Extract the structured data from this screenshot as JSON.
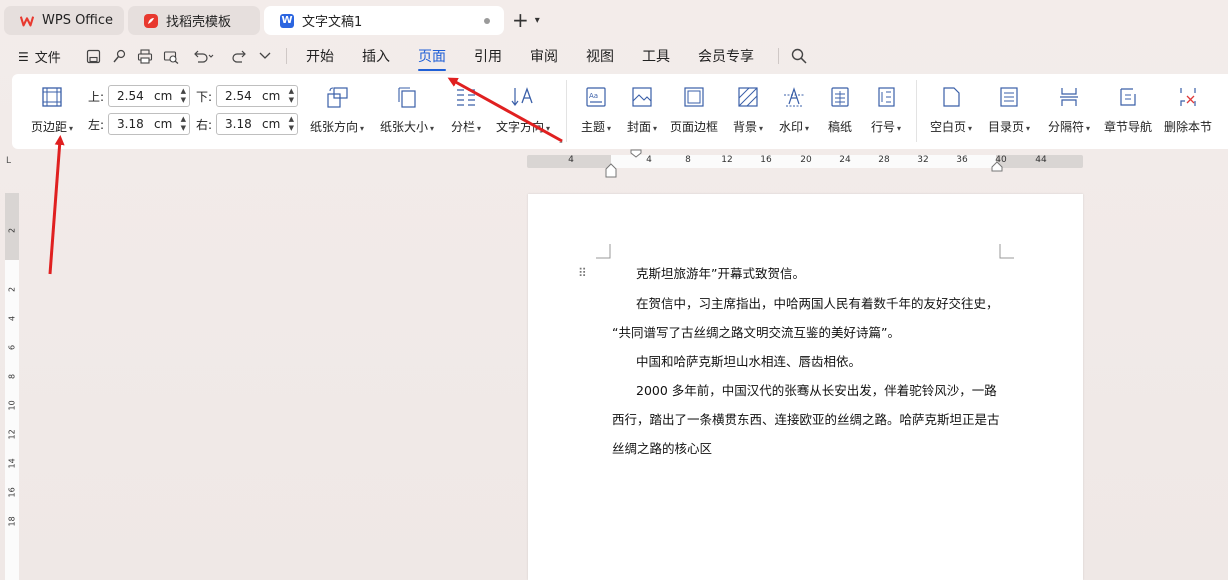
{
  "tabs": [
    {
      "label": "WPS Office",
      "icon": "wps-logo-icon"
    },
    {
      "label": "找稻壳模板",
      "icon": "docer-logo-icon"
    },
    {
      "label": "文字文稿1",
      "icon": "writer-doc-icon"
    }
  ],
  "menubar": {
    "file_label": "文件",
    "items": [
      "开始",
      "插入",
      "页面",
      "引用",
      "审阅",
      "视图",
      "工具",
      "会员专享"
    ],
    "active": "页面"
  },
  "ribbon": {
    "margins_label": "页边距",
    "margin_top_label": "上:",
    "margin_top_value": "2.54",
    "margin_bottom_label": "下:",
    "margin_bottom_value": "2.54",
    "margin_left_label": "左:",
    "margin_left_value": "3.18",
    "margin_right_label": "右:",
    "margin_right_value": "3.18",
    "unit": "cm",
    "orientation_label": "纸张方向",
    "size_label": "纸张大小",
    "columns_label": "分栏",
    "text_direction_label": "文字方向",
    "theme_label": "主题",
    "cover_label": "封面",
    "page_border_label": "页面边框",
    "background_label": "背景",
    "watermark_label": "水印",
    "manuscript_label": "稿纸",
    "line_number_label": "行号",
    "blank_page_label": "空白页",
    "toc_page_label": "目录页",
    "separator_label": "分隔符",
    "chapter_nav_label": "章节导航",
    "delete_section_label": "删除本节"
  },
  "ruler": {
    "h_numbers": [
      "4",
      "4",
      "8",
      "12",
      "16",
      "20",
      "24",
      "28",
      "32",
      "36",
      "40",
      "44"
    ],
    "v_numbers": [
      "2",
      "2",
      "4",
      "6",
      "8",
      "10",
      "12",
      "14",
      "16",
      "18"
    ],
    "corner": "L"
  },
  "document": {
    "paragraphs": [
      "克斯坦旅游年”开幕式致贺信。",
      "在贺信中，习主席指出，中哈两国人民有着数千年的友好交往史，",
      "“共同谱写了古丝绸之路文明交流互鉴的美好诗篇”。",
      "中国和哈萨克斯坦山水相连、唇齿相依。",
      "2000 多年前，中国汉代的张骞从长安出发，伴着驼铃风沙，一路",
      "西行，踏出了一条横贯东西、连接欧亚的丝绸之路。哈萨克斯坦正是古",
      "丝绸之路的核心区"
    ]
  },
  "colors": {
    "accent": "#1f5fd6",
    "annotation_arrow": "#e02020",
    "wps_red": "#e8392f",
    "writer_blue": "#2b65e0"
  }
}
